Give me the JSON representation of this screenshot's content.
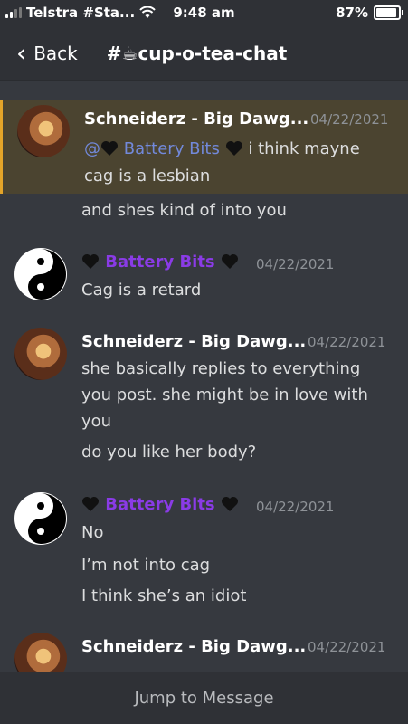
{
  "status": {
    "carrier": "Telstra #Sta...",
    "time": "9:48 am",
    "battery": "87%"
  },
  "header": {
    "back_label": "Back",
    "channel": "#☕cup-o-tea-chat"
  },
  "messages": [
    {
      "author": "Schneiderz - Big Dawg...",
      "timestamp": "04/22/2021",
      "lines": [
        "@",
        "Battery Bits",
        "i think mayne",
        "cag is a lesbian",
        "and shes kind of into you"
      ]
    },
    {
      "author": "Battery Bits",
      "timestamp": "04/22/2021",
      "lines": [
        "Cag is a retard"
      ]
    },
    {
      "author": "Schneiderz - Big Dawg...",
      "timestamp": "04/22/2021",
      "lines": [
        "she basically replies to everything",
        "you post. she might be in love with",
        "you",
        "do you like her body?"
      ]
    },
    {
      "author": "Battery Bits",
      "timestamp": "04/22/2021",
      "lines": [
        "No",
        "I’m not into cag",
        "I think she’s an idiot"
      ]
    },
    {
      "author": "Schneiderz - Big Dawg...",
      "timestamp": "04/22/2021",
      "lines": []
    }
  ],
  "bottom": {
    "jump_label": "Jump to Message"
  },
  "icons": [
    "wifi-icon",
    "battery-icon",
    "back-chevron-icon",
    "black-heart-icon",
    "yin-yang-icon"
  ],
  "colors": {
    "background": "#36393f",
    "header": "#2f3136",
    "mention": "#7289da",
    "name_purple": "#8a3be6",
    "highlight_border": "#e3a429"
  }
}
